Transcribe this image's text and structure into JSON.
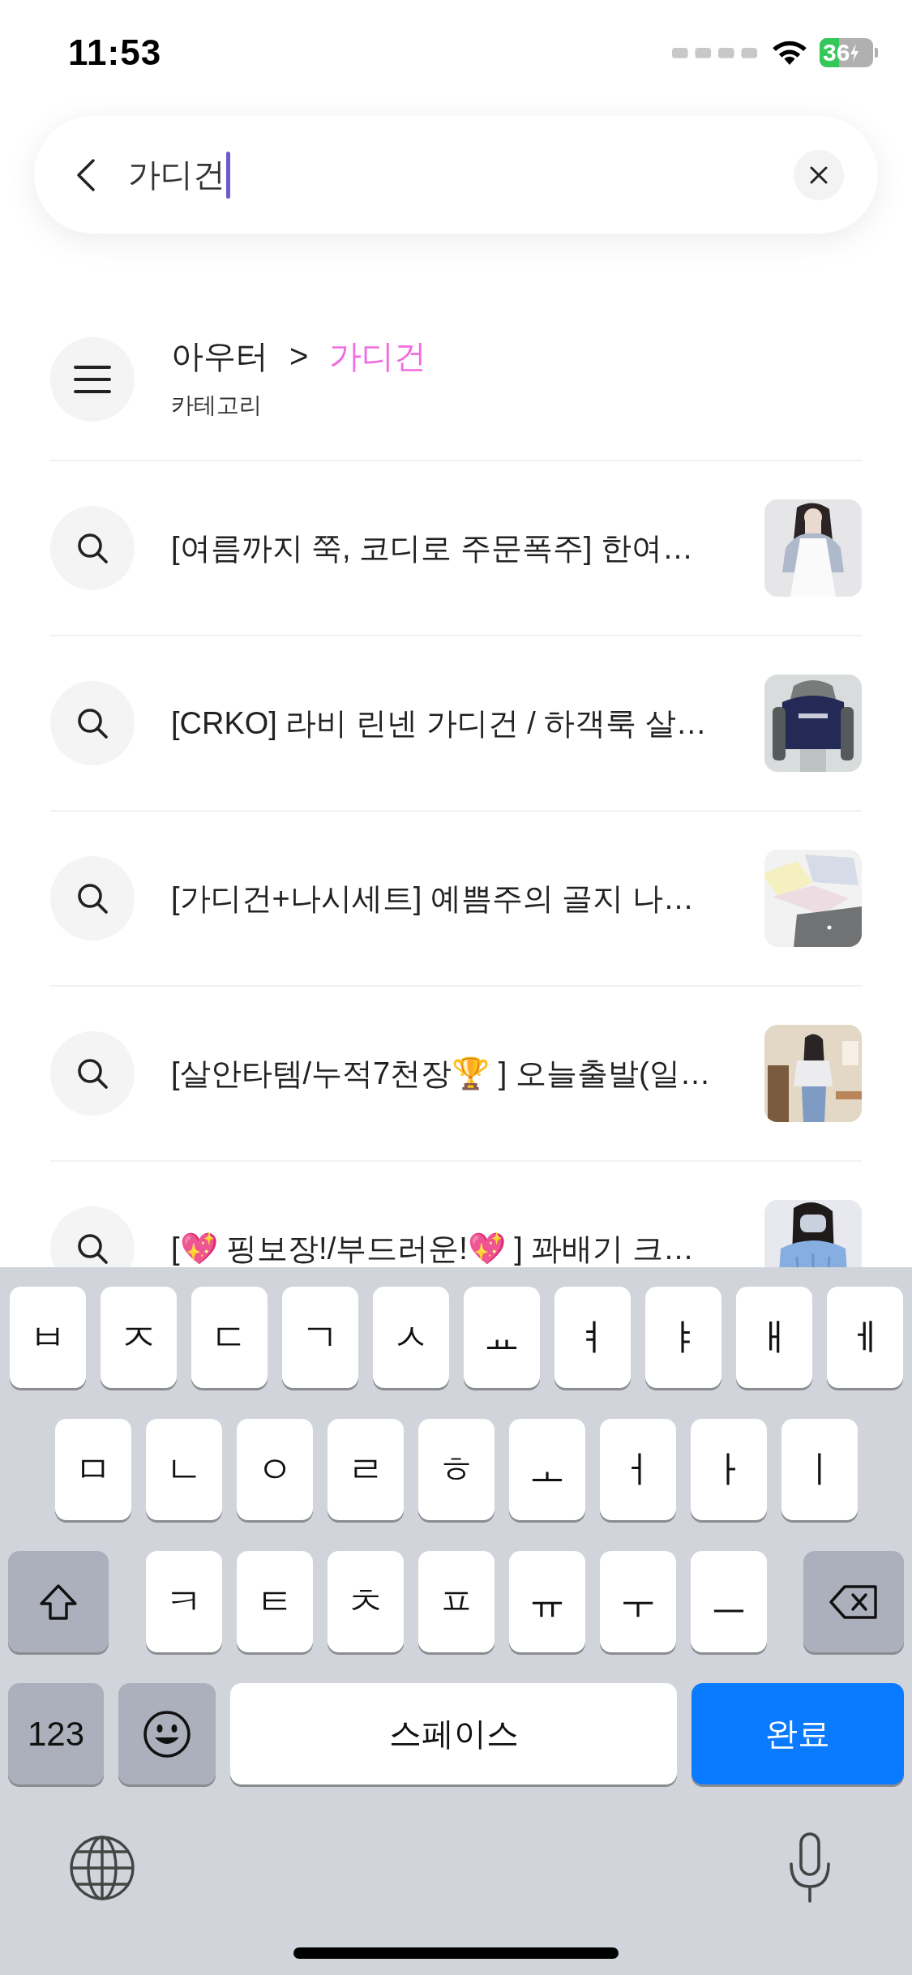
{
  "status_bar": {
    "time": "11:53",
    "battery": "36"
  },
  "search": {
    "value": "가디건"
  },
  "category": {
    "parent": "아우터",
    "separator": ">",
    "current": "가디건",
    "label": "카테고리"
  },
  "suggestions": [
    {
      "text": "[여름까지 쭉, 코디로 주문폭주] 한여…"
    },
    {
      "text": "[CRKO] 라비 린넨 가디건 / 하객룩 살…"
    },
    {
      "text": "[가디건+나시세트] 예쁨주의 골지 나…"
    },
    {
      "text": "[살안타템/누적7천장🏆 ] 오늘출발(일…"
    },
    {
      "text": "[💖 핑보장!/부드러운!💖 ] 꽈배기 크…"
    }
  ],
  "keyboard": {
    "rows": [
      [
        {
          "kind": "char",
          "label": "ㅂ"
        },
        {
          "kind": "char",
          "label": "ㅈ"
        },
        {
          "kind": "char",
          "label": "ㄷ"
        },
        {
          "kind": "char",
          "label": "ㄱ"
        },
        {
          "kind": "char",
          "label": "ㅅ"
        },
        {
          "kind": "char",
          "label": "ㅛ"
        },
        {
          "kind": "char",
          "label": "ㅕ"
        },
        {
          "kind": "char",
          "label": "ㅑ"
        },
        {
          "kind": "char",
          "label": "ㅐ"
        },
        {
          "kind": "char",
          "label": "ㅔ"
        }
      ],
      [
        {
          "kind": "char",
          "label": "ㅁ"
        },
        {
          "kind": "char",
          "label": "ㄴ"
        },
        {
          "kind": "char",
          "label": "ㅇ"
        },
        {
          "kind": "char",
          "label": "ㄹ"
        },
        {
          "kind": "char",
          "label": "ㅎ"
        },
        {
          "kind": "char",
          "label": "ㅗ"
        },
        {
          "kind": "char",
          "label": "ㅓ"
        },
        {
          "kind": "char",
          "label": "ㅏ"
        },
        {
          "kind": "char",
          "label": "ㅣ"
        }
      ],
      [
        {
          "kind": "shift"
        },
        {
          "kind": "char",
          "label": "ㅋ"
        },
        {
          "kind": "char",
          "label": "ㅌ"
        },
        {
          "kind": "char",
          "label": "ㅊ"
        },
        {
          "kind": "char",
          "label": "ㅍ"
        },
        {
          "kind": "char",
          "label": "ㅠ"
        },
        {
          "kind": "char",
          "label": "ㅜ"
        },
        {
          "kind": "char",
          "label": "ㅡ"
        },
        {
          "kind": "backspace"
        }
      ]
    ],
    "bottom_keys": {
      "numbers": "123",
      "space": "스페이스",
      "done": "완료"
    }
  }
}
